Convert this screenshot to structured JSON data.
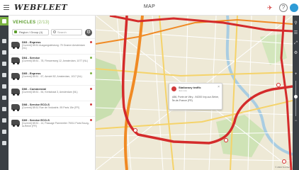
{
  "app": {
    "logo": "WEBFLEET",
    "title": "MAP"
  },
  "header_icons": [
    "bell-icon",
    "help-icon",
    "user-avatar"
  ],
  "rail": {
    "icons": [
      "vehicles-icon",
      "upload-icon",
      "tag-icon",
      "alert-icon",
      "truck-icon",
      "chart-icon",
      "user-icon",
      "calendar-icon",
      "message-icon",
      "clock-icon",
      "settings-icon"
    ],
    "active_index": 0
  },
  "panel": {
    "heading": "VEHICLES",
    "count": "(2/13)",
    "filter_label": "Region / Group (4)",
    "search_placeholder": "Search",
    "vehicles": [
      {
        "name": "D03 - Express",
        "address": "[Current] 08:51 Ausgangsleistung: 75 Gramm Amsterdam (NL)",
        "status_color": "#d23b3b"
      },
      {
        "name": "D04 - Service",
        "address": "[Current] 08:51 - 78, Flessenweg 12, Amsterdam, 1077 (NL)",
        "status_color": "#7cb342"
      },
      {
        "name": "D05 - Express",
        "address": "[Current] 08:51 - 67, Amstel 82, Amsterdam, 1017 (NL)",
        "status_color": "#7cb342"
      },
      {
        "name": "D06 - Commercial",
        "address": "[Current] 08:51 - 54, Kerkstraat 3, Amsterdam (NL)",
        "status_color": "#d23b3b"
      },
      {
        "name": "D08 - Service ECO-S",
        "address": "[Current] 08:51 Rue de l'Industrie, 95 Paris 15e (FR)",
        "status_color": "#d23b3b"
      },
      {
        "name": "D09 - Service ECO-S",
        "address": "[Current] 08:51 - 14, Passage Parmentier 75011 Paris Bourg-la-Reine (FR)",
        "status_color": "#d23b3b"
      }
    ]
  },
  "map": {
    "popup": {
      "title": "Stationary traffic",
      "subtitle": "Just now",
      "address": "A86, Porte de Vitry - 94200 Ivry-sur-Seine, Île-de-France (FR)"
    },
    "attribution": "© 2024 TomTom"
  },
  "colors": {
    "brand_green": "#7cb342",
    "rail_dark": "#3a3f44",
    "route_red": "#d42b2b",
    "route_orange": "#f08a24",
    "map_land": "#eee9d6",
    "map_park": "#c9dfb0",
    "map_water": "#a9cde2"
  }
}
